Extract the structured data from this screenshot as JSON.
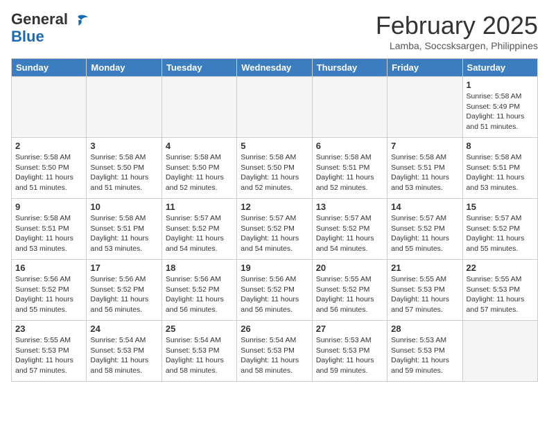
{
  "header": {
    "logo_general": "General",
    "logo_blue": "Blue",
    "month_title": "February 2025",
    "location": "Lamba, Soccsksargen, Philippines"
  },
  "days_of_week": [
    "Sunday",
    "Monday",
    "Tuesday",
    "Wednesday",
    "Thursday",
    "Friday",
    "Saturday"
  ],
  "weeks": [
    [
      {
        "day": "",
        "info": ""
      },
      {
        "day": "",
        "info": ""
      },
      {
        "day": "",
        "info": ""
      },
      {
        "day": "",
        "info": ""
      },
      {
        "day": "",
        "info": ""
      },
      {
        "day": "",
        "info": ""
      },
      {
        "day": "1",
        "info": "Sunrise: 5:58 AM\nSunset: 5:49 PM\nDaylight: 11 hours and 51 minutes."
      }
    ],
    [
      {
        "day": "2",
        "info": "Sunrise: 5:58 AM\nSunset: 5:50 PM\nDaylight: 11 hours and 51 minutes."
      },
      {
        "day": "3",
        "info": "Sunrise: 5:58 AM\nSunset: 5:50 PM\nDaylight: 11 hours and 51 minutes."
      },
      {
        "day": "4",
        "info": "Sunrise: 5:58 AM\nSunset: 5:50 PM\nDaylight: 11 hours and 52 minutes."
      },
      {
        "day": "5",
        "info": "Sunrise: 5:58 AM\nSunset: 5:50 PM\nDaylight: 11 hours and 52 minutes."
      },
      {
        "day": "6",
        "info": "Sunrise: 5:58 AM\nSunset: 5:51 PM\nDaylight: 11 hours and 52 minutes."
      },
      {
        "day": "7",
        "info": "Sunrise: 5:58 AM\nSunset: 5:51 PM\nDaylight: 11 hours and 53 minutes."
      },
      {
        "day": "8",
        "info": "Sunrise: 5:58 AM\nSunset: 5:51 PM\nDaylight: 11 hours and 53 minutes."
      }
    ],
    [
      {
        "day": "9",
        "info": "Sunrise: 5:58 AM\nSunset: 5:51 PM\nDaylight: 11 hours and 53 minutes."
      },
      {
        "day": "10",
        "info": "Sunrise: 5:58 AM\nSunset: 5:51 PM\nDaylight: 11 hours and 53 minutes."
      },
      {
        "day": "11",
        "info": "Sunrise: 5:57 AM\nSunset: 5:52 PM\nDaylight: 11 hours and 54 minutes."
      },
      {
        "day": "12",
        "info": "Sunrise: 5:57 AM\nSunset: 5:52 PM\nDaylight: 11 hours and 54 minutes."
      },
      {
        "day": "13",
        "info": "Sunrise: 5:57 AM\nSunset: 5:52 PM\nDaylight: 11 hours and 54 minutes."
      },
      {
        "day": "14",
        "info": "Sunrise: 5:57 AM\nSunset: 5:52 PM\nDaylight: 11 hours and 55 minutes."
      },
      {
        "day": "15",
        "info": "Sunrise: 5:57 AM\nSunset: 5:52 PM\nDaylight: 11 hours and 55 minutes."
      }
    ],
    [
      {
        "day": "16",
        "info": "Sunrise: 5:56 AM\nSunset: 5:52 PM\nDaylight: 11 hours and 55 minutes."
      },
      {
        "day": "17",
        "info": "Sunrise: 5:56 AM\nSunset: 5:52 PM\nDaylight: 11 hours and 56 minutes."
      },
      {
        "day": "18",
        "info": "Sunrise: 5:56 AM\nSunset: 5:52 PM\nDaylight: 11 hours and 56 minutes."
      },
      {
        "day": "19",
        "info": "Sunrise: 5:56 AM\nSunset: 5:52 PM\nDaylight: 11 hours and 56 minutes."
      },
      {
        "day": "20",
        "info": "Sunrise: 5:55 AM\nSunset: 5:52 PM\nDaylight: 11 hours and 56 minutes."
      },
      {
        "day": "21",
        "info": "Sunrise: 5:55 AM\nSunset: 5:53 PM\nDaylight: 11 hours and 57 minutes."
      },
      {
        "day": "22",
        "info": "Sunrise: 5:55 AM\nSunset: 5:53 PM\nDaylight: 11 hours and 57 minutes."
      }
    ],
    [
      {
        "day": "23",
        "info": "Sunrise: 5:55 AM\nSunset: 5:53 PM\nDaylight: 11 hours and 57 minutes."
      },
      {
        "day": "24",
        "info": "Sunrise: 5:54 AM\nSunset: 5:53 PM\nDaylight: 11 hours and 58 minutes."
      },
      {
        "day": "25",
        "info": "Sunrise: 5:54 AM\nSunset: 5:53 PM\nDaylight: 11 hours and 58 minutes."
      },
      {
        "day": "26",
        "info": "Sunrise: 5:54 AM\nSunset: 5:53 PM\nDaylight: 11 hours and 58 minutes."
      },
      {
        "day": "27",
        "info": "Sunrise: 5:53 AM\nSunset: 5:53 PM\nDaylight: 11 hours and 59 minutes."
      },
      {
        "day": "28",
        "info": "Sunrise: 5:53 AM\nSunset: 5:53 PM\nDaylight: 11 hours and 59 minutes."
      },
      {
        "day": "",
        "info": ""
      }
    ]
  ]
}
